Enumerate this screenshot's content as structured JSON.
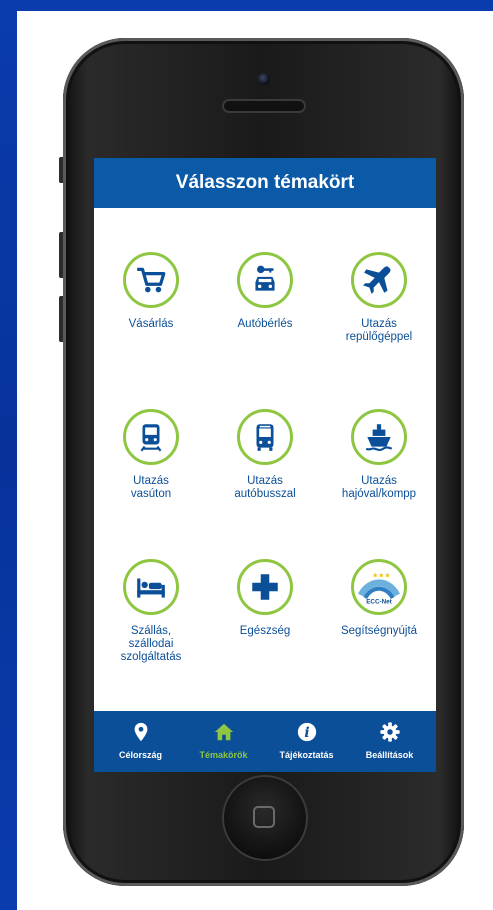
{
  "header": {
    "title": "Válasszon témakört"
  },
  "tiles": [
    {
      "label": "Vásárlás",
      "icon": "shopping-cart-icon"
    },
    {
      "label": "Autóbérlés",
      "icon": "car-key-icon"
    },
    {
      "label": "Utazás\nrepülőgéppel",
      "icon": "airplane-icon"
    },
    {
      "label": "Utazás\nvasúton",
      "icon": "train-icon"
    },
    {
      "label": "Utazás\nautóbusszal",
      "icon": "bus-icon"
    },
    {
      "label": "Utazás\nhajóval/kompp",
      "icon": "ship-icon"
    },
    {
      "label": "Szállás,\nszállodai\nszolgáltatás",
      "icon": "bed-icon"
    },
    {
      "label": "Egészség",
      "icon": "medical-cross-icon"
    },
    {
      "label": "Segítségnyújtá",
      "icon": "ecc-net-logo-icon",
      "logo_text": "ECC-Net"
    }
  ],
  "tabbar": {
    "active": "Témakörök",
    "tabs": [
      {
        "label": "Célország",
        "icon": "location-pin-icon"
      },
      {
        "label": "Témakörök",
        "icon": "home-icon"
      },
      {
        "label": "Tájékoztatás",
        "icon": "info-icon"
      },
      {
        "label": "Beállítások",
        "icon": "gear-icon"
      }
    ]
  },
  "colors": {
    "header_bg": "#0b5aa8",
    "label_blue": "#0b4f98",
    "accent_green": "#8ec641",
    "slide_bg": "#0a3aa8"
  }
}
